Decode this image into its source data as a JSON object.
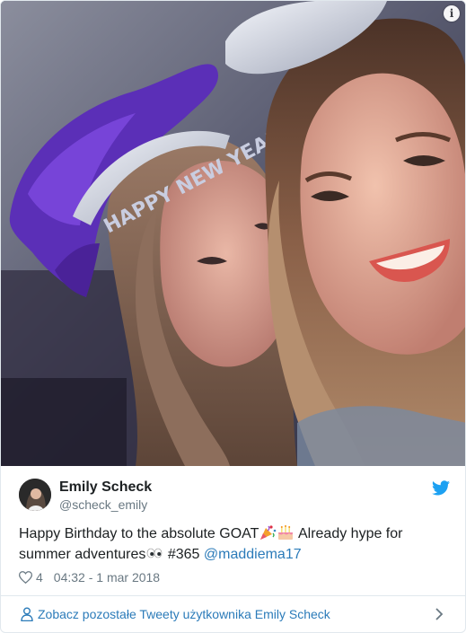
{
  "tweet": {
    "author_name": "Emily Scheck",
    "author_handle": "@scheck_emily",
    "text_start": "Happy Birthday to the absolute GOAT",
    "text_middle": " Already hype for summer adventures",
    "text_hashtag": " #365 ",
    "mention": "@maddiema17",
    "emojis": [
      "party-popper-icon",
      "birthday-cake-icon",
      "eyes-icon"
    ],
    "like_count": "4",
    "timestamp": "04:32 - 1 mar 2018"
  },
  "photo": {
    "headband_text": "HAPPY NEW YEAR",
    "info_glyph": "i"
  },
  "footer": {
    "link_text": "Zobacz pozostałe Tweety użytkownika Emily Scheck"
  },
  "colors": {
    "link": "#2b7bb9",
    "text": "#1c2022",
    "muted": "#697882",
    "border": "#e1e8ed",
    "twitter_blue": "#1da1f2"
  }
}
